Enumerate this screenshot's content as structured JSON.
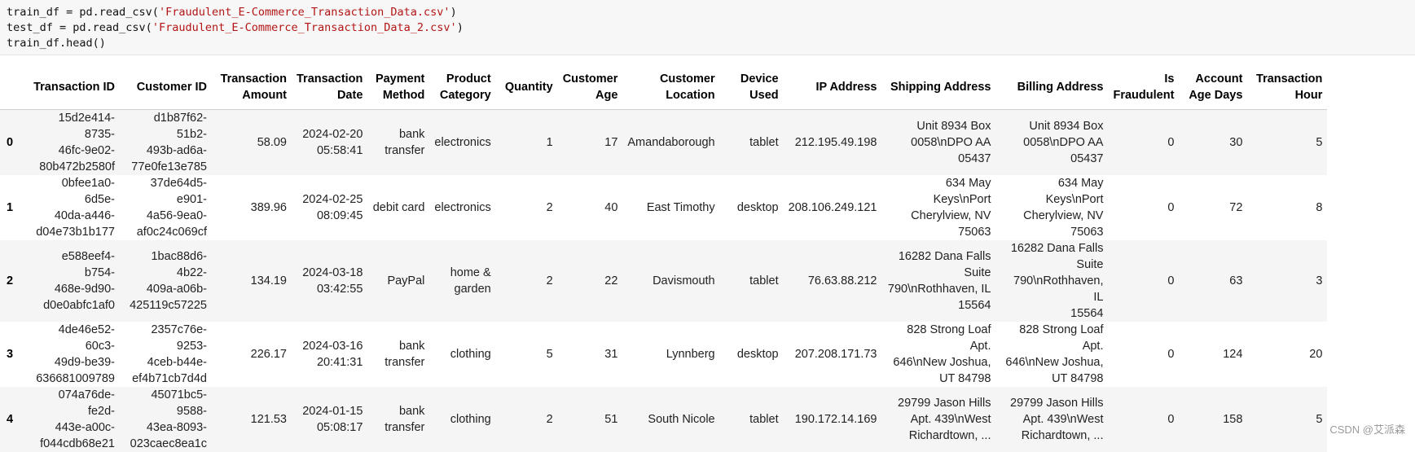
{
  "code": {
    "line1_pre": "train_df = pd.read_csv(",
    "line1_str": "'Fraudulent_E-Commerce_Transaction_Data.csv'",
    "line1_post": ")",
    "line2_pre": "test_df = pd.read_csv(",
    "line2_str": "'Fraudulent_E-Commerce_Transaction_Data_2.csv'",
    "line2_post": ")",
    "line3": "train_df.head()"
  },
  "table": {
    "headers": [
      [
        "Transaction ID",
        ""
      ],
      [
        "Customer ID",
        ""
      ],
      [
        "Transaction",
        "Amount"
      ],
      [
        "Transaction",
        "Date"
      ],
      [
        "Payment",
        "Method"
      ],
      [
        "Product",
        "Category"
      ],
      [
        "Quantity",
        ""
      ],
      [
        "Customer",
        "Age"
      ],
      [
        "Customer",
        "Location"
      ],
      [
        "Device",
        "Used"
      ],
      [
        "IP Address",
        ""
      ],
      [
        "Shipping Address",
        ""
      ],
      [
        "Billing Address",
        ""
      ],
      [
        "Is",
        "Fraudulent"
      ],
      [
        "Account",
        "Age Days"
      ],
      [
        "Transaction",
        "Hour"
      ]
    ],
    "rows": [
      {
        "index": "0",
        "txid": [
          "15d2e414-8735-",
          "46fc-9e02-",
          "80b472b2580f"
        ],
        "custid": [
          "d1b87f62-51b2-",
          "493b-ad6a-",
          "77e0fe13e785"
        ],
        "amount": "58.09",
        "date": [
          "2024-02-20",
          "05:58:41"
        ],
        "payment": [
          "bank",
          "transfer"
        ],
        "category": [
          "electronics"
        ],
        "quantity": "1",
        "age": "17",
        "location": "Amandaborough",
        "device": "tablet",
        "ip": "212.195.49.198",
        "shipping": [
          "Unit 8934 Box",
          "0058\\nDPO AA",
          "05437"
        ],
        "billing": [
          "Unit 8934 Box",
          "0058\\nDPO AA",
          "05437"
        ],
        "fraud": "0",
        "account_days": "30",
        "hour": "5"
      },
      {
        "index": "1",
        "txid": [
          "0bfee1a0-6d5e-",
          "40da-a446-",
          "d04e73b1b177"
        ],
        "custid": [
          "37de64d5-e901-",
          "4a56-9ea0-",
          "af0c24c069cf"
        ],
        "amount": "389.96",
        "date": [
          "2024-02-25",
          "08:09:45"
        ],
        "payment": [
          "debit card"
        ],
        "category": [
          "electronics"
        ],
        "quantity": "2",
        "age": "40",
        "location": "East Timothy",
        "device": "desktop",
        "ip": "208.106.249.121",
        "shipping": [
          "634 May Keys\\nPort",
          "Cherylview, NV",
          "75063"
        ],
        "billing": [
          "634 May Keys\\nPort",
          "Cherylview, NV",
          "75063"
        ],
        "fraud": "0",
        "account_days": "72",
        "hour": "8"
      },
      {
        "index": "2",
        "txid": [
          "e588eef4-b754-",
          "468e-9d90-",
          "d0e0abfc1af0"
        ],
        "custid": [
          "1bac88d6-4b22-",
          "409a-a06b-",
          "425119c57225"
        ],
        "amount": "134.19",
        "date": [
          "2024-03-18",
          "03:42:55"
        ],
        "payment": [
          "PayPal"
        ],
        "category": [
          "home &",
          "garden"
        ],
        "quantity": "2",
        "age": "22",
        "location": "Davismouth",
        "device": "tablet",
        "ip": "76.63.88.212",
        "shipping": [
          "16282 Dana Falls",
          "Suite",
          "790\\nRothhaven, IL",
          "15564"
        ],
        "billing": [
          "16282 Dana Falls",
          "Suite",
          "790\\nRothhaven, IL",
          "15564"
        ],
        "fraud": "0",
        "account_days": "63",
        "hour": "3"
      },
      {
        "index": "3",
        "txid": [
          "4de46e52-60c3-",
          "49d9-be39-",
          "636681009789"
        ],
        "custid": [
          "2357c76e-9253-",
          "4ceb-b44e-",
          "ef4b71cb7d4d"
        ],
        "amount": "226.17",
        "date": [
          "2024-03-16",
          "20:41:31"
        ],
        "payment": [
          "bank",
          "transfer"
        ],
        "category": [
          "clothing"
        ],
        "quantity": "5",
        "age": "31",
        "location": "Lynnberg",
        "device": "desktop",
        "ip": "207.208.171.73",
        "shipping": [
          "828 Strong Loaf Apt.",
          "646\\nNew Joshua,",
          "UT 84798"
        ],
        "billing": [
          "828 Strong Loaf Apt.",
          "646\\nNew Joshua,",
          "UT 84798"
        ],
        "fraud": "0",
        "account_days": "124",
        "hour": "20"
      },
      {
        "index": "4",
        "txid": [
          "074a76de-fe2d-",
          "443e-a00c-",
          "f044cdb68e21"
        ],
        "custid": [
          "45071bc5-9588-",
          "43ea-8093-",
          "023caec8ea1c"
        ],
        "amount": "121.53",
        "date": [
          "2024-01-15",
          "05:08:17"
        ],
        "payment": [
          "bank",
          "transfer"
        ],
        "category": [
          "clothing"
        ],
        "quantity": "2",
        "age": "51",
        "location": "South Nicole",
        "device": "tablet",
        "ip": "190.172.14.169",
        "shipping": [
          "29799 Jason Hills",
          "Apt. 439\\nWest",
          "Richardtown, ..."
        ],
        "billing": [
          "29799 Jason Hills",
          "Apt. 439\\nWest",
          "Richardtown, ..."
        ],
        "fraud": "0",
        "account_days": "158",
        "hour": "5"
      }
    ]
  },
  "watermark": "CSDN @艾派森"
}
